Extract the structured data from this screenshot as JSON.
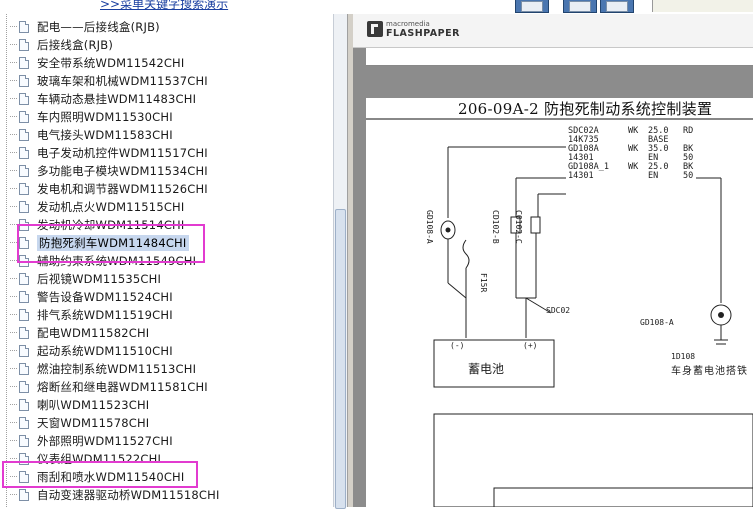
{
  "top": {
    "search_link": ">>菜单关键字搜索演示"
  },
  "tree": {
    "items": [
      {
        "label": "配电——后接线盒(RJB)"
      },
      {
        "label": "后接线盒(RJB)"
      },
      {
        "label": "安全带系统WDM11542CHI"
      },
      {
        "label": "玻璃车架和机械WDM11537CHI"
      },
      {
        "label": "车辆动态悬挂WDM11483CHI"
      },
      {
        "label": "车内照明WDM11530CHI"
      },
      {
        "label": "电气接头WDM11583CHI"
      },
      {
        "label": "电子发动机控件WDM11517CHI"
      },
      {
        "label": "多功能电子模块WDM11534CHI"
      },
      {
        "label": "发电机和调节器WDM11526CHI"
      },
      {
        "label": "发动机点火WDM11515CHI"
      },
      {
        "label": "发动机冷却WDM11514CHI"
      },
      {
        "label": "防抱死刹车WDM11484CHI",
        "selected": true
      },
      {
        "label": "辅助约束系统WDM11549CHI"
      },
      {
        "label": "后视镜WDM11535CHI"
      },
      {
        "label": "警告设备WDM11524CHI"
      },
      {
        "label": "排气系统WDM11519CHI"
      },
      {
        "label": "配电WDM11582CHI"
      },
      {
        "label": "起动系统WDM11510CHI"
      },
      {
        "label": "燃油控制系统WDM11513CHI"
      },
      {
        "label": "熔断丝和继电器WDM11581CHI"
      },
      {
        "label": "喇叭WDM11523CHI"
      },
      {
        "label": "天窗WDM11578CHI"
      },
      {
        "label": "外部照明WDM11527CHI"
      },
      {
        "label": "仪表组WDM11522CHI"
      },
      {
        "label": "雨刮和喷水WDM11540CHI"
      },
      {
        "label": "自动变速器驱动桥WDM11518CHI"
      }
    ]
  },
  "viewer": {
    "brand_small": "macromedia",
    "brand_big": "FLASHPAPER",
    "page_title": "206-09A-2 防抱死制动系统控制装置",
    "wire_table": [
      {
        "a": "SDC02A",
        "b": "WK",
        "c": "25.0",
        "d": "RD"
      },
      {
        "a": "14K735",
        "b": "",
        "c": "BASE",
        "d": ""
      },
      {
        "a": "GD108A",
        "b": "WK",
        "c": "35.0",
        "d": "BK"
      },
      {
        "a": "14301",
        "b": "",
        "c": "EN",
        "d": "50"
      },
      {
        "a": "GD108A_1",
        "b": "WK",
        "c": "25.0",
        "d": "BK"
      },
      {
        "a": "14301",
        "b": "",
        "c": "EN",
        "d": "50"
      }
    ],
    "labels": {
      "c1": "GD108-A",
      "c2": "CD102-B",
      "c3": "C0102-C",
      "fuse": "F15R",
      "relay": "SDC02",
      "ground": "GD108-A",
      "g_neg": "(-)",
      "g_pos": "(+)",
      "battery": "蓄电池",
      "id1": "1D108",
      "body_ground": "车身蓄电池搭铁"
    },
    "colors": {
      "highlight": "#e23bd0",
      "selection": "#c7d7ee"
    }
  }
}
